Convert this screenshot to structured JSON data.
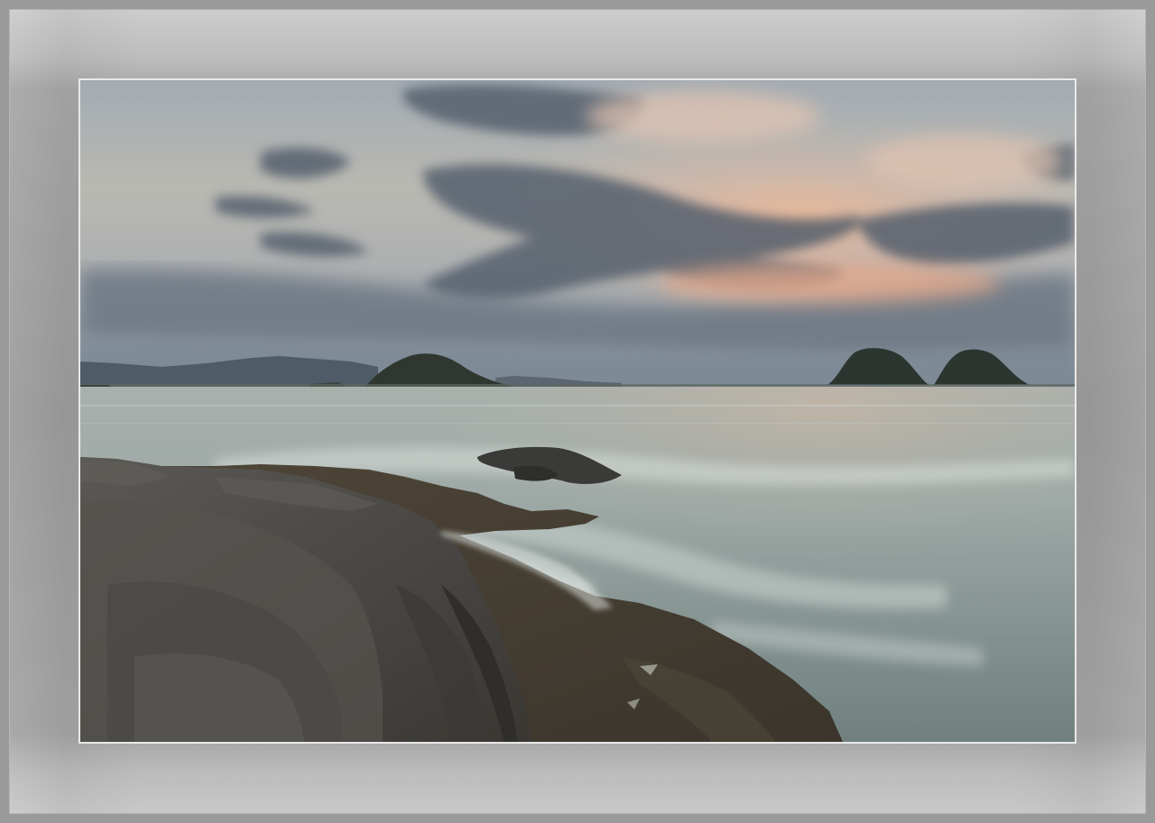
{
  "scene": {
    "subject": "seascape-at-dusk",
    "elements": [
      "cloudy-sky",
      "distant-mountains",
      "small-islands",
      "calm-sea",
      "rocky-shore"
    ]
  },
  "colors": {
    "frame": "#9a9a9a",
    "mat_light": "#cdcdcd",
    "mat_dark": "#9c9c9c",
    "photo_border": "#e9e9e9",
    "sky_top": "#9aa4ae",
    "sky_glow": "#e4b49a",
    "cloud_dark": "#4f5a66",
    "sea": "#8f9ea0",
    "rock": "#4e4d4a"
  }
}
